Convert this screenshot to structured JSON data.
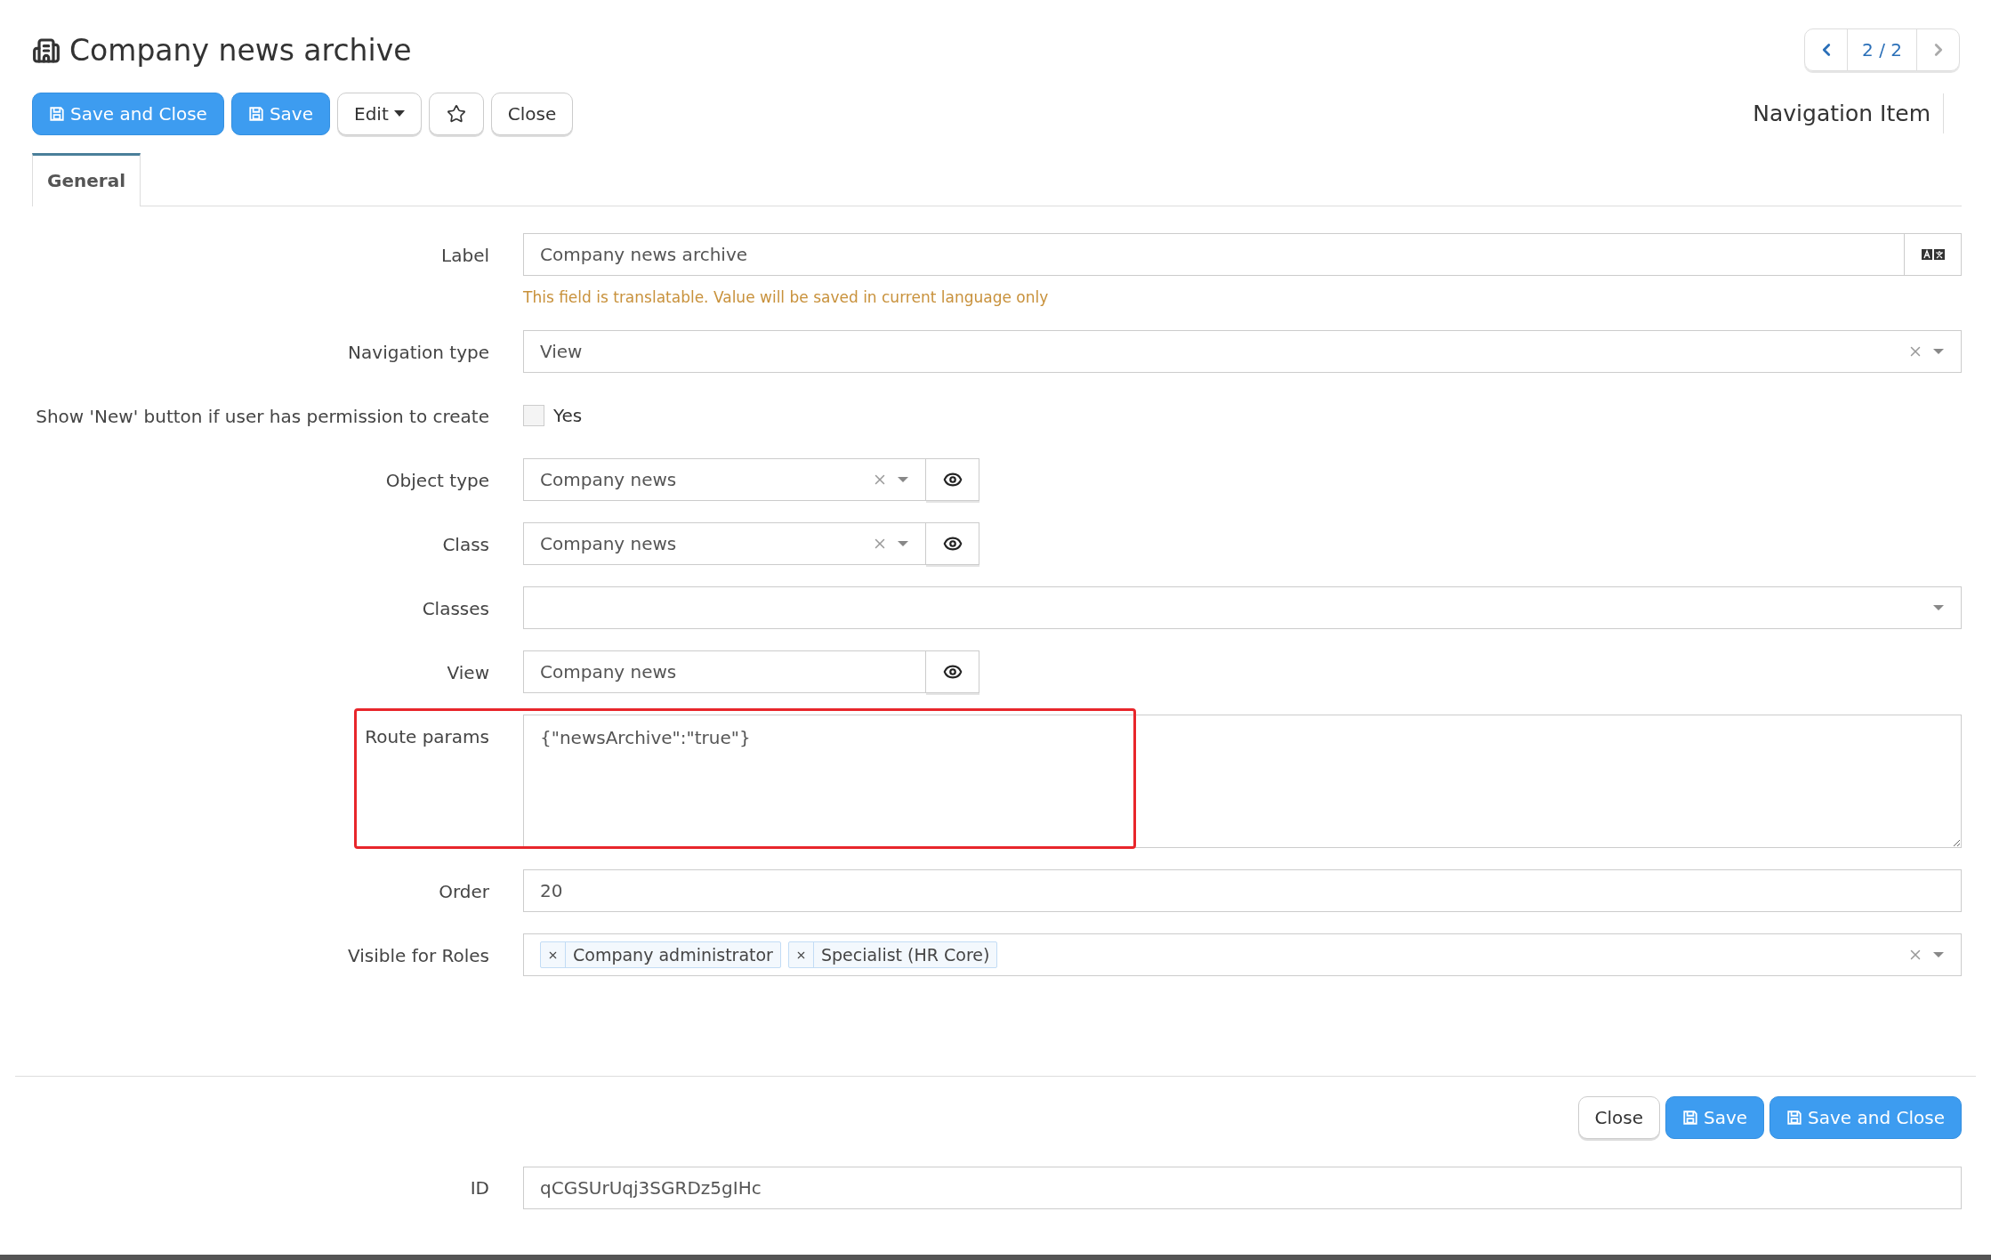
{
  "header": {
    "title": "Company news archive",
    "pager": {
      "label": "2 / 2",
      "prev_disabled": false,
      "next_disabled": true
    },
    "entity_type": "Navigation Item"
  },
  "toolbar": [
    {
      "kind": "primary",
      "label": "Save and Close"
    },
    {
      "kind": "primary",
      "label": "Save"
    },
    {
      "kind": "dropdown",
      "label": "Edit"
    },
    {
      "kind": "star"
    },
    {
      "kind": "default",
      "label": "Close"
    }
  ],
  "tabs": [
    {
      "label": "General",
      "selected": true
    }
  ],
  "fields": [
    {
      "kind": "text",
      "label": "Label",
      "value": "Company news archive",
      "translatable": true,
      "hint": "This field is translatable. Value will be saved in current language only"
    },
    {
      "kind": "select",
      "label": "Navigation type",
      "value": "View",
      "clearable": true
    },
    {
      "kind": "checkbox",
      "label": "Show 'New' button if user has permission to create",
      "option": "Yes",
      "checked": false
    },
    {
      "kind": "lookup",
      "label": "Object type",
      "value": "Company news",
      "clearable": true
    },
    {
      "kind": "lookup",
      "label": "Class",
      "value": "Company news",
      "clearable": true
    },
    {
      "kind": "select",
      "label": "Classes",
      "clearable": false
    },
    {
      "kind": "link",
      "label": "View",
      "value": "Company news"
    },
    {
      "kind": "textarea",
      "label": "Route params",
      "value": "{\"newsArchive\":\"true\"}",
      "highlighted": true
    },
    {
      "kind": "text",
      "label": "Order",
      "value": "20"
    },
    {
      "kind": "tags",
      "label": "Visible for Roles",
      "tags": [
        "Company administrator",
        "Specialist (HR Core)"
      ],
      "clearable": true
    }
  ],
  "footer_buttons": [
    {
      "kind": "default",
      "label": "Close"
    },
    {
      "kind": "primary",
      "label": "Save"
    },
    {
      "kind": "primary",
      "label": "Save and Close"
    }
  ],
  "id_field": {
    "label": "ID",
    "value": "qCGSUrUqj3SGRDz5gIHc"
  }
}
